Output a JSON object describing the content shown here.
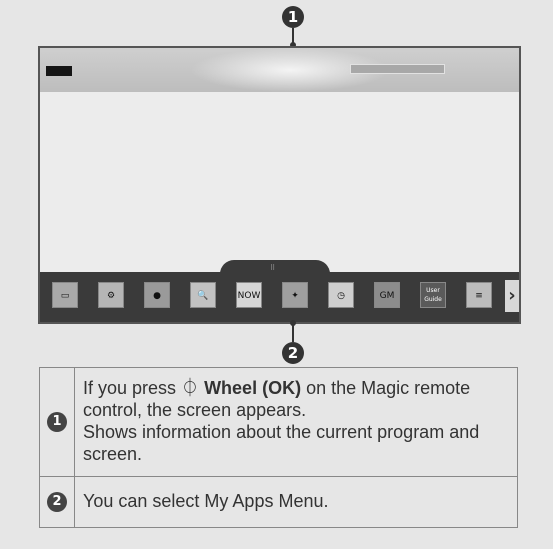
{
  "callouts": {
    "top": "1",
    "bottom": "2"
  },
  "apps": [
    {
      "icon": "media-player-icon",
      "glyph": "▭",
      "bg": "#a9a9a9"
    },
    {
      "icon": "settings-gear-icon",
      "glyph": "⚙",
      "bg": "#b5b5b5"
    },
    {
      "icon": "internet-globe-icon",
      "glyph": "●",
      "bg": "#9a9a9a"
    },
    {
      "icon": "search-icon",
      "glyph": "🔍",
      "bg": "#c2c2c2"
    },
    {
      "icon": "now-hot-icon",
      "glyph": "NOW",
      "bg": "#d6d6d6"
    },
    {
      "icon": "smart-share-icon",
      "glyph": "✦",
      "bg": "#9f9f9f"
    },
    {
      "icon": "clock-icon",
      "glyph": "◷",
      "bg": "#cfcfcf"
    },
    {
      "icon": "game-icon",
      "glyph": "GM",
      "bg": "#8c8c8c"
    },
    {
      "icon": "user-guide-icon",
      "glyph": "User Guide",
      "bg": "#5a5a5a"
    },
    {
      "icon": "channel-list-icon",
      "glyph": "≡",
      "bg": "#bcbcbc"
    }
  ],
  "table": {
    "rows": [
      {
        "number": "1",
        "text_lead": "If you press ",
        "button_symbol": "⏀",
        "button_label": "Wheel (OK)",
        "text_tail": " on the Magic remote control, the screen appears.",
        "text_line2": "Shows information about the current program and screen."
      },
      {
        "number": "2",
        "text": "You can select My Apps Menu."
      }
    ]
  }
}
